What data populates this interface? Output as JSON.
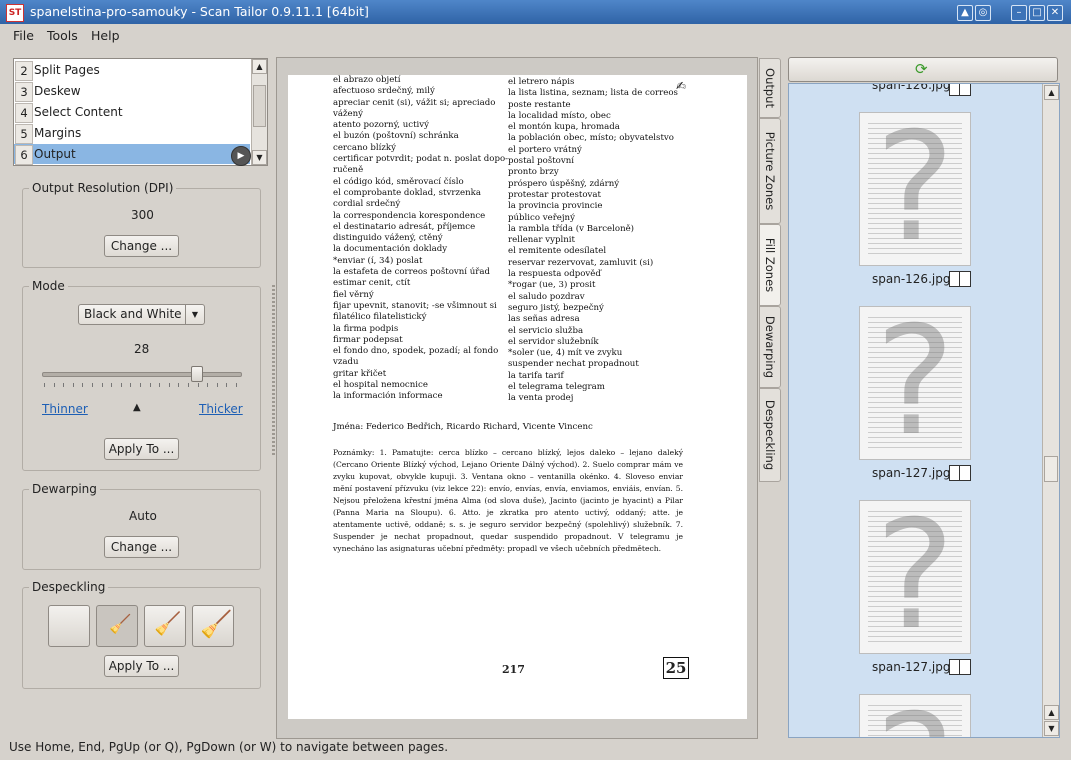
{
  "window": {
    "title": "spanelstina-pro-samouky - Scan Tailor 0.9.11.1 [64bit]",
    "icon_text": "ST"
  },
  "menu": [
    "File",
    "Tools",
    "Help"
  ],
  "stages": [
    {
      "num": "2",
      "label": "Split Pages"
    },
    {
      "num": "3",
      "label": "Deskew"
    },
    {
      "num": "4",
      "label": "Select Content"
    },
    {
      "num": "5",
      "label": "Margins"
    },
    {
      "num": "6",
      "label": "Output"
    }
  ],
  "output_resolution": {
    "title": "Output Resolution (DPI)",
    "value": "300",
    "button": "Change ..."
  },
  "mode": {
    "title": "Mode",
    "selected": "Black and White",
    "threshold": "28",
    "threshold_level": 0.79,
    "thinner": "Thinner",
    "thicker": "Thicker",
    "apply": "Apply To ..."
  },
  "dewarping": {
    "title": "Dewarping",
    "value": "Auto",
    "button": "Change ..."
  },
  "despeckling": {
    "title": "Despeckling",
    "apply": "Apply To ..."
  },
  "view_tabs": [
    "Output",
    "Picture Zones",
    "Fill Zones",
    "Dewarping",
    "Despeckling"
  ],
  "document": {
    "left_col": [
      "el abrazo objetí",
      "afectuoso srdečný, milý",
      "apreciar cenit (si), vážit si; apreciado",
      "    vážený",
      "atento pozorný, uctivý",
      "el buzón (poštovní) schránka",
      "cercano blízký",
      "certificar potvrdit; podat n. poslat dopo-",
      "    ručeně",
      "el código kód, směrovací číslo",
      "el comprobante doklad, stvrzenka",
      "cordial srdečný",
      "la correspondencia korespondence",
      "el destinatario adresát, příjemce",
      "distinguido vážený, ctěný",
      "la documentación doklady",
      "*enviar (í, 34) poslat",
      "la estafeta de correos poštovní úřad",
      "estimar cenit, ctít",
      "fiel věrný",
      "fijar upevnit, stanovit; -se všimnout si",
      "filatélico filatelistický",
      "la firma podpis",
      "firmar podepsat",
      "el fondo dno, spodek, pozadí; al fondo",
      "    vzadu",
      "gritar křičet",
      "el hospital nemocnice",
      "la información informace"
    ],
    "right_col": [
      "el letrero nápis",
      "la lista listina, seznam; lista de correos",
      "    poste restante",
      "la localidad místo, obec",
      "el montón kupa, hromada",
      "la población obec, místo; obyvatelstvo",
      "el portero vrátný",
      "postal poštovní",
      "pronto brzy",
      "próspero úspěšný, zdárný",
      "protestar protestovat",
      "la provincia provincie",
      "público veřejný",
      "la rambla třída (v Barceloně)",
      "rellenar vyplnit",
      "el remitente odesílatel",
      "reservar rezervovat, zamluvit (si)",
      "la respuesta odpověď",
      "*rogar (ue, 3) prosit",
      "el saludo pozdrav",
      "seguro jistý, bezpečný",
      "las señas adresa",
      "el servicio služba",
      "el servidor služebník",
      "*soler (ue, 4) mít ve zvyku",
      "suspender nechat propadnout",
      "la tarifa tarif",
      "el telegrama telegram",
      "la venta prodej"
    ],
    "names": "Jména: Federico Bedřich, Ricardo Richard, Vicente Vincenc",
    "notes": "Poznámky: 1. Pamatujte: cerca blízko – cercano blízký, lejos daleko – lejano daleký (Cercano Oriente Blízký východ, Lejano Oriente Dálný východ). 2. Suelo comprar mám ve zvyku kupovat, obvykle kupuji. 3. Ventana okno – ventanilla okénko. 4. Sloveso enviar mění postavení přízvuku (viz lekce 22): envío, envías, envía, enviamos, enviáis, envían. 5. Nejsou přeložena křestní jména Alma (od slova duše), Jacinto (jacinto je hyacint) a Pilar (Panna Maria na Sloupu). 6. Atto. je zkratka pro atento uctivý, oddaný; atte. je atentamente uctivě, oddaně; s. s. je seguro servidor bezpečný (spolehlivý) služebník. 7. Suspender je nechat propadnout, quedar suspendido propadnout. V telegramu je vynecháno las asignaturas učební předměty: propadl ve všech učebních předmětech.",
    "page_number": "217",
    "lesson_number": "25"
  },
  "thumbnails": [
    {
      "label": "span-126.jpg"
    },
    {
      "label": "span-126.jpg"
    },
    {
      "label": "span-127.jpg"
    },
    {
      "label": "span-127.jpg"
    }
  ],
  "status": "Use Home, End, PgUp (or Q), PgDown (or W) to navigate between pages.",
  "colors": {
    "titlebar": "#2f63a6",
    "selection": "#8ab6e3",
    "thumb_panel": "#cfe0f2",
    "link": "#1d5fb5"
  }
}
